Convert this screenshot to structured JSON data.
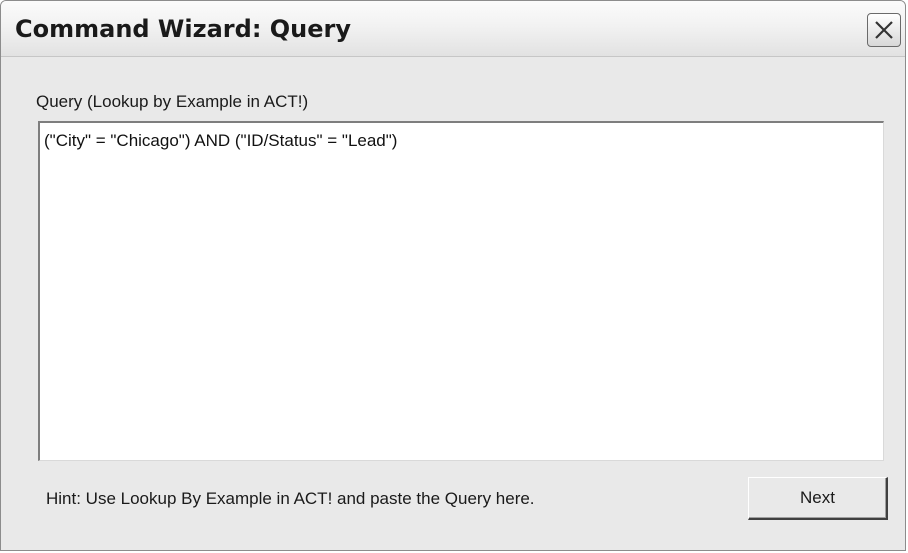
{
  "window": {
    "title": "Command Wizard: Query",
    "close_icon": "close-icon"
  },
  "query": {
    "label": "Query (Lookup by Example in ACT!)",
    "value": "(\"City\" = \"Chicago\") AND (\"ID/Status\" = \"Lead\")"
  },
  "footer": {
    "hint": "Hint: Use Lookup By Example in ACT! and paste the Query here.",
    "next_label": "Next"
  }
}
